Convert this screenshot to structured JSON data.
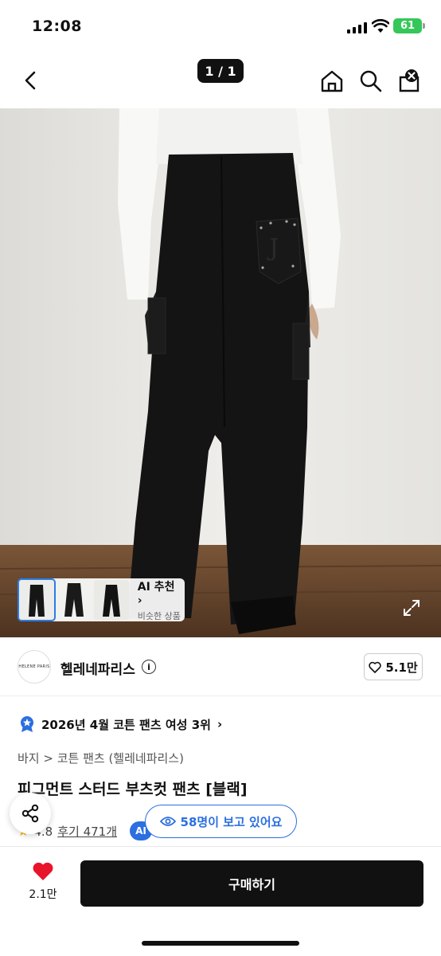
{
  "status_bar": {
    "time": "12:08",
    "battery": "61"
  },
  "nav": {
    "counter": "1 / 1"
  },
  "hero": {
    "ai_recommend_title": "AI 추천",
    "ai_recommend_sub": "비슷한 상품"
  },
  "brand": {
    "name": "헬레네파리스",
    "logo_text": "HELENE PARIS",
    "likes": "5.1만"
  },
  "rank": {
    "text": "2026년 4월 코튼 팬츠 여성 3위"
  },
  "breadcrumb": {
    "text": "바지 > 코튼 팬츠 (헬레네파리스)"
  },
  "product": {
    "title": "피그먼트 스터드 부츠컷 팬츠 [블랙]",
    "rating": "4.8",
    "reviews": "후기 471개",
    "ai_badge": "AI",
    "viewers": "58명이 보고 있어요"
  },
  "bottom": {
    "wish_count": "2.1만",
    "buy_label": "구매하기"
  },
  "colors": {
    "accent_blue": "#2b6fe0",
    "heart_red": "#e8142a",
    "battery_green": "#35c759"
  }
}
